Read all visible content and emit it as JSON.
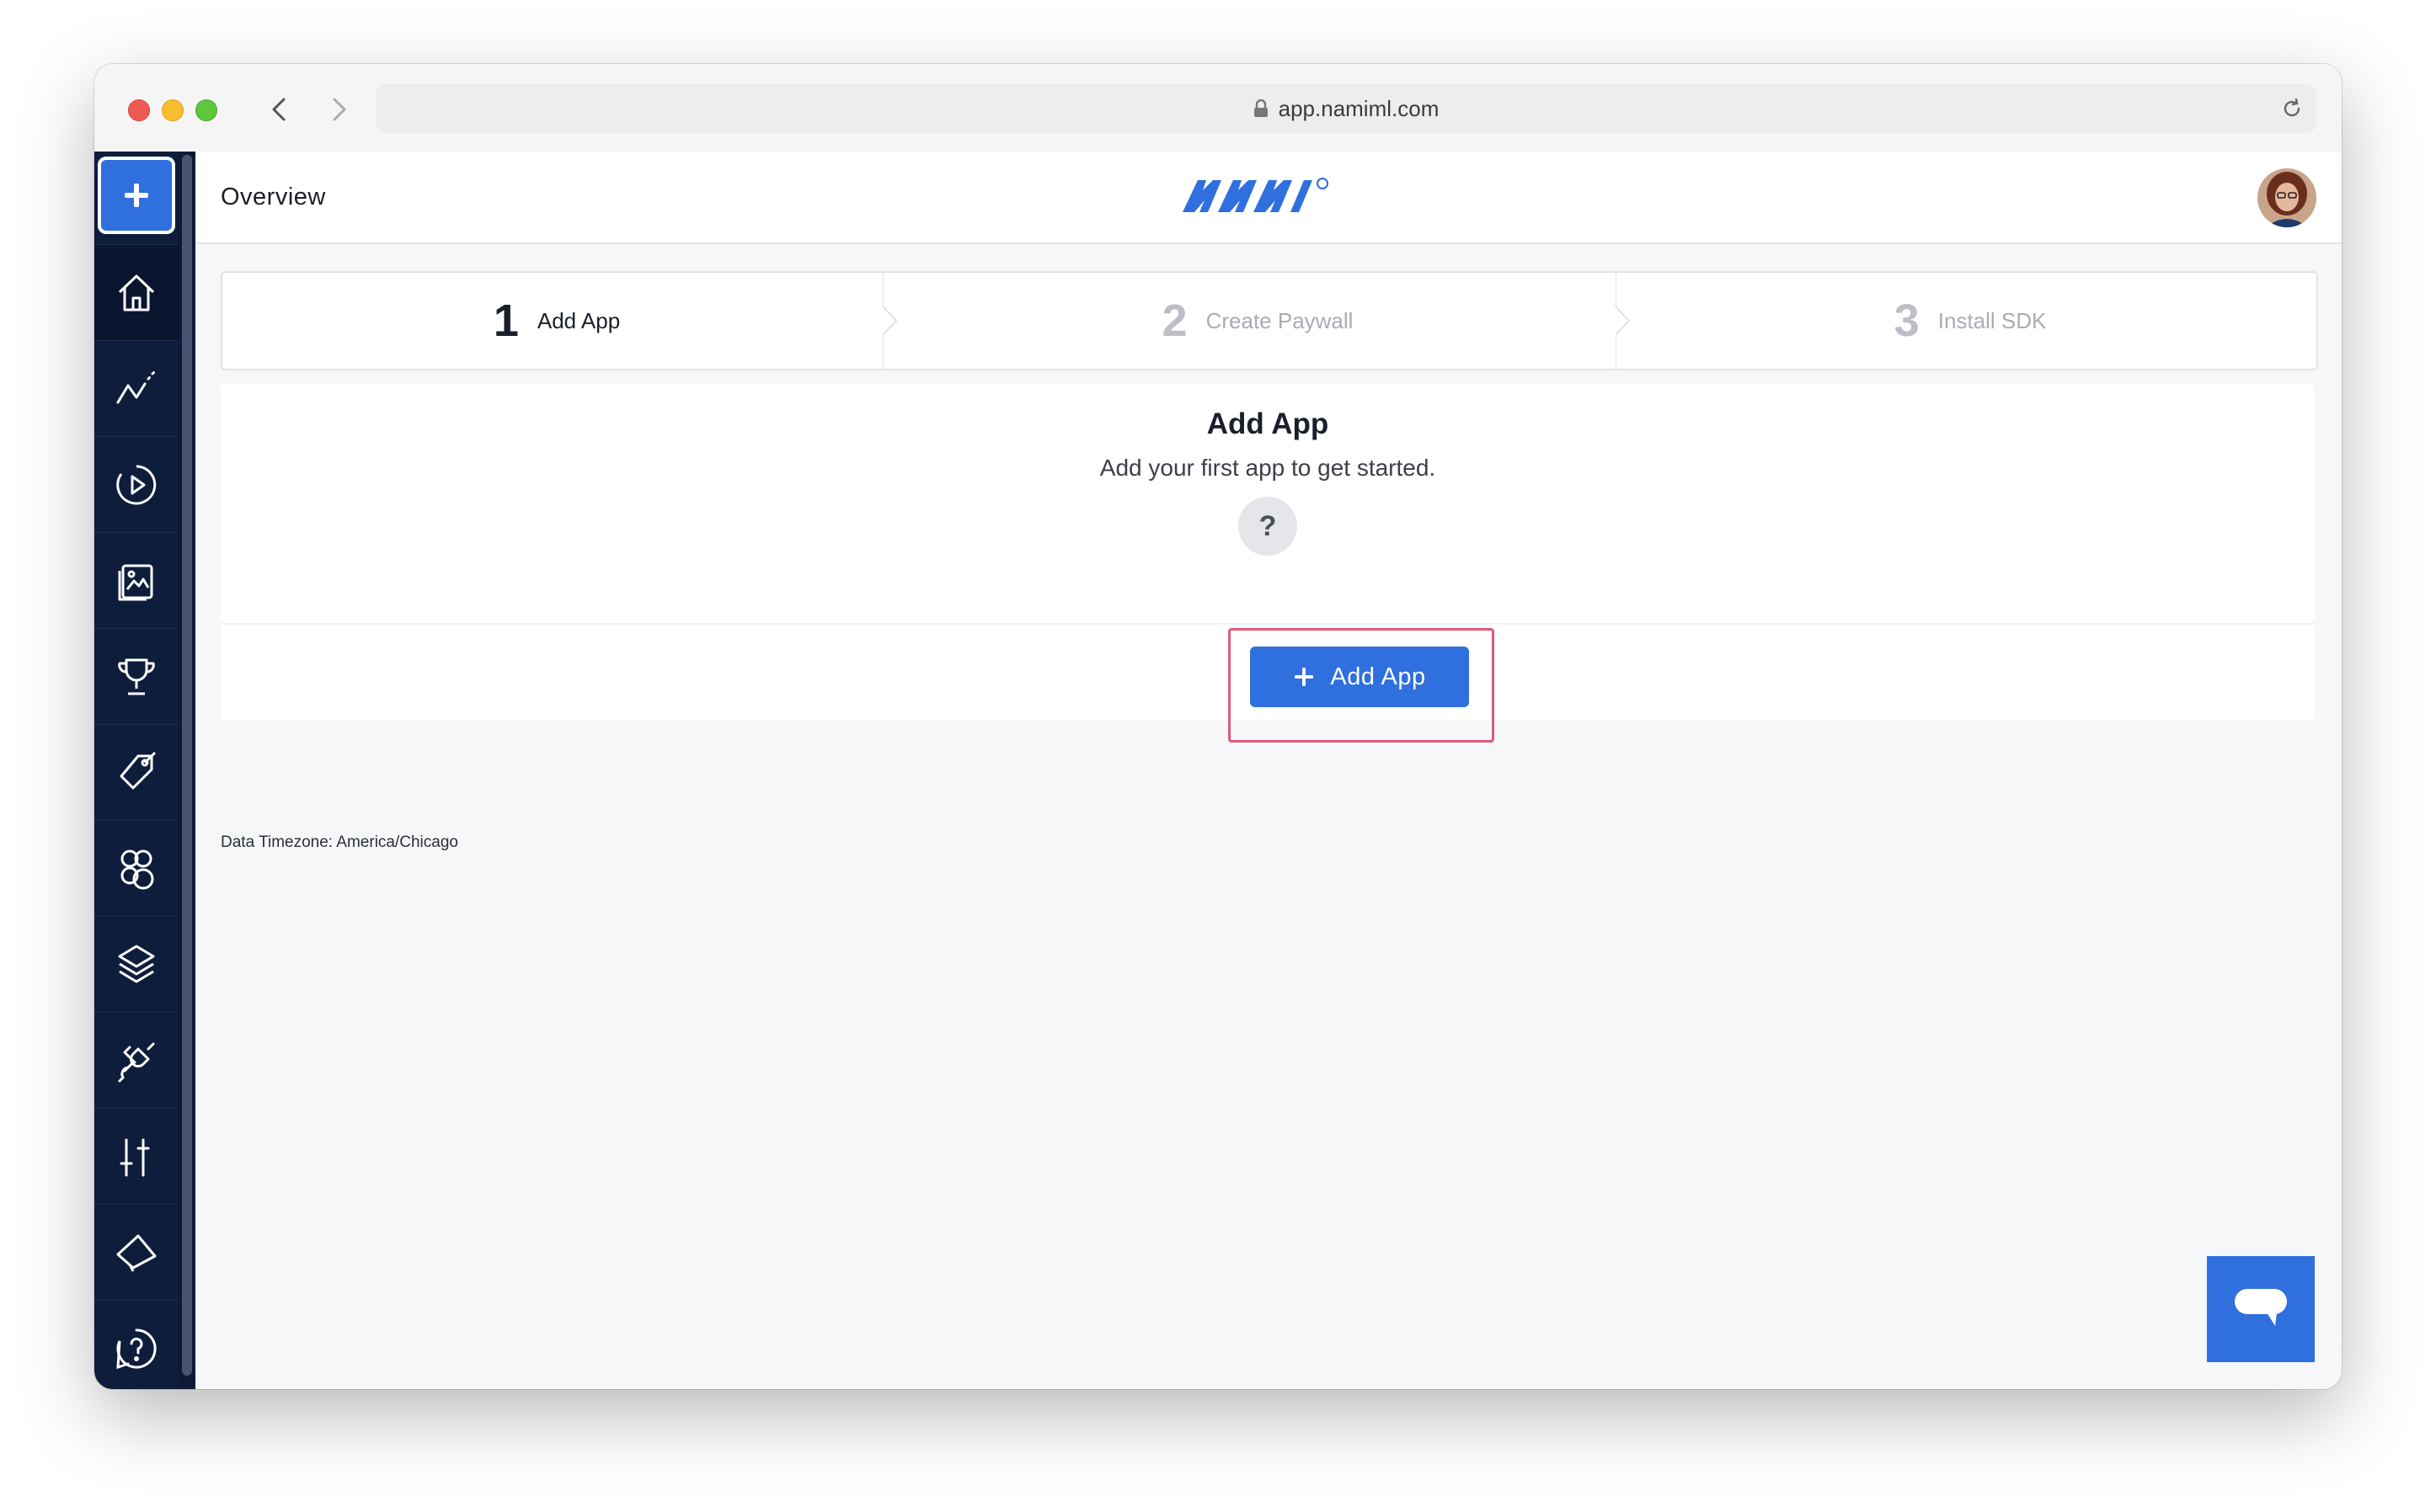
{
  "browser": {
    "url": "app.namiml.com"
  },
  "header": {
    "page_title": "Overview"
  },
  "sidebar": {
    "items": [
      {
        "name": "home-icon"
      },
      {
        "name": "analytics-icon"
      },
      {
        "name": "campaigns-icon"
      },
      {
        "name": "paywalls-icon"
      },
      {
        "name": "entitlements-icon"
      },
      {
        "name": "products-icon"
      },
      {
        "name": "customers-icon"
      },
      {
        "name": "apps-icon"
      },
      {
        "name": "integrations-icon"
      },
      {
        "name": "settings-icon"
      },
      {
        "name": "announcements-icon"
      },
      {
        "name": "help-icon"
      }
    ]
  },
  "stepper": {
    "steps": [
      {
        "number": "1",
        "label": "Add App",
        "active": true
      },
      {
        "number": "2",
        "label": "Create Paywall",
        "active": false
      },
      {
        "number": "3",
        "label": "Install SDK",
        "active": false
      }
    ]
  },
  "card": {
    "title": "Add App",
    "subtitle": "Add your first app to get started.",
    "help_glyph": "?",
    "button_label": "Add App"
  },
  "footer": {
    "timezone": "Data Timezone: America/Chicago"
  },
  "colors": {
    "accent": "#2f6fde",
    "sidebar": "#0f1d3d",
    "highlight": "#e0587a"
  }
}
